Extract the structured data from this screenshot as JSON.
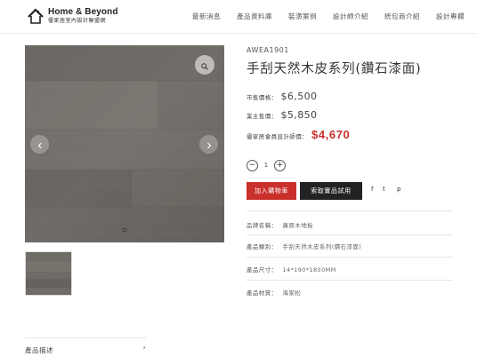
{
  "brand": {
    "title": "Home & Beyond",
    "subtitle": "優家居室內設計聯盟網"
  },
  "nav": {
    "items": [
      "最新消息",
      "產品資料庫",
      "裝潢案例",
      "設計師介紹",
      "統包商介紹",
      "設計專欄"
    ]
  },
  "product": {
    "sku": "AWEA1901",
    "title": "手刮天然木皮系列(鑽石漆面)",
    "prices": {
      "retail_label": "市售價格：",
      "retail_value": "$6,500",
      "dealer_label": "業主售價：",
      "dealer_value": "$5,850",
      "member_label": "優家居會員設計師價：",
      "member_value": "$4,670"
    },
    "quantity": "1",
    "buttons": {
      "add_to_cart": "加入購物車",
      "apply_sample": "索取實品試用",
      "share": [
        "f",
        "t",
        "p"
      ]
    },
    "attributes": [
      {
        "label": "品牌名稱：",
        "value": "廣原木地板"
      },
      {
        "label": "產品類別：",
        "value": "手刮天然木皮系列(鑽石漆面)"
      },
      {
        "label": "產品尺寸：",
        "value": "14*190*1850MM"
      },
      {
        "label": "產品材質：",
        "value": "海棠松"
      }
    ]
  },
  "gallery": {
    "zoom_icon": "magnifier-icon",
    "prev_icon": "chevron-left-icon",
    "next_icon": "chevron-right-icon"
  },
  "accordion": {
    "description_label": "產品描述",
    "toggle_icon": "chevron-right-icon"
  },
  "colors": {
    "accent": "#c9302c",
    "dark": "#222222"
  }
}
